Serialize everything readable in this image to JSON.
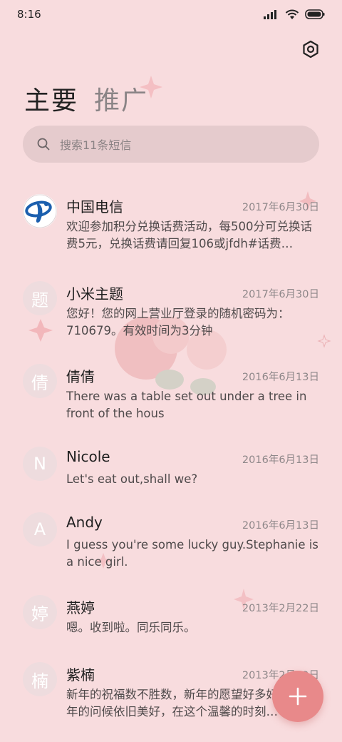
{
  "status_bar": {
    "time": "8:16"
  },
  "tabs": [
    {
      "label": "主要"
    },
    {
      "label": "推广"
    }
  ],
  "search": {
    "placeholder": "搜索11条短信"
  },
  "conversations": [
    {
      "avatar_char": "",
      "avatar_type": "china-telecom-logo",
      "name": "中国电信",
      "date": "2017年6月30日",
      "preview": "欢迎参加积分兑换话费活动，每500分可兑换话费5元，兑换话费请回复106或jfdh#话费…"
    },
    {
      "avatar_char": "题",
      "name": "小米主题",
      "date": "2017年6月30日",
      "preview": "您好！您的网上营业厅登录的随机密码为：710679。有效时间为3分钟"
    },
    {
      "avatar_char": "倩",
      "name": "倩倩",
      "date": "2016年6月13日",
      "preview": "There was a table set out under a tree in front of the hous"
    },
    {
      "avatar_char": "N",
      "name": "Nicole",
      "date": "2016年6月13日",
      "preview": "Let's eat out,shall we?"
    },
    {
      "avatar_char": "A",
      "name": "Andy",
      "date": "2016年6月13日",
      "preview": "I guess you're some lucky guy.Stephanie is a nice girl."
    },
    {
      "avatar_char": "婷",
      "name": "燕婷",
      "date": "2013年2月22日",
      "preview": "嗯。收到啦。同乐同乐。"
    },
    {
      "avatar_char": "楠",
      "name": "紫楠",
      "date": "2013年2月22日",
      "preview": "新年的祝福数不胜数，新年的愿望好多好多，新年的问候依旧美好，在这个温馨的时刻…"
    }
  ],
  "icons": {
    "settings": "gear-icon",
    "search": "search-icon",
    "fab": "plus-icon"
  },
  "colors": {
    "background": "#f8dcde",
    "fab": "#e8898a",
    "avatar": "#eedcde"
  }
}
